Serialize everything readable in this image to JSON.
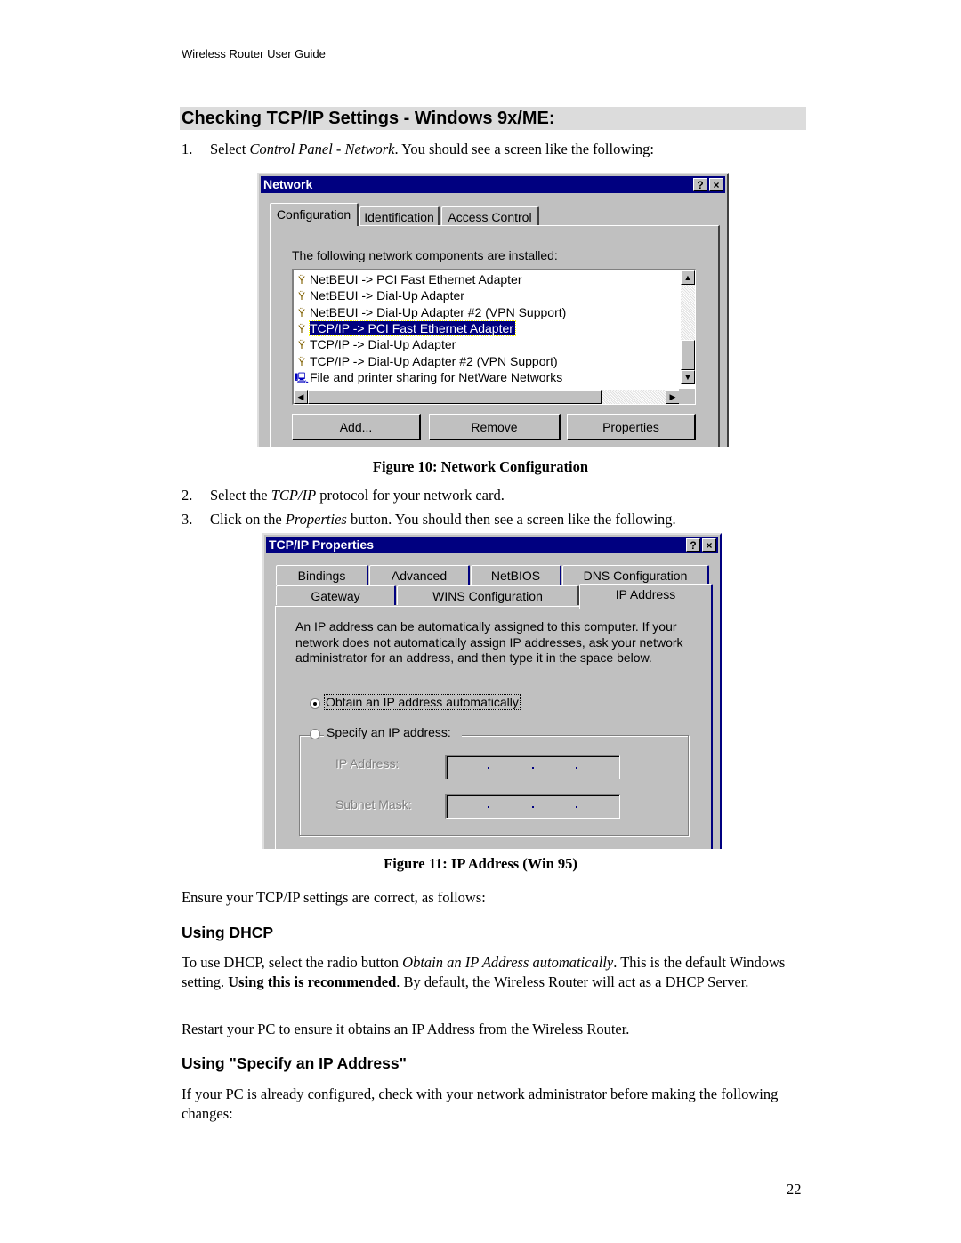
{
  "page": {
    "running_head": "Wireless Router User Guide",
    "section_title": "Checking TCP/IP Settings - Windows 9x/ME:",
    "page_number": "22"
  },
  "steps": [
    {
      "num": "1.",
      "pre": "Select ",
      "em": "Control Panel - Network",
      "post": ". You should see a screen like the following:"
    },
    {
      "num": "2.",
      "pre": "Select the ",
      "em": "TCP/IP",
      "post": " protocol for your network card."
    },
    {
      "num": "3.",
      "pre": "Click on the ",
      "em": "Properties",
      "post": " button. You should then see a screen like the following."
    }
  ],
  "figure10": {
    "caption": "Figure 10: Network Configuration",
    "dialog": {
      "title": "Network",
      "help_button": "?",
      "close_button": "×",
      "tabs": [
        "Configuration",
        "Identification",
        "Access Control"
      ],
      "active_tab": "Configuration",
      "list_label": "The following network components are installed:",
      "list_items": [
        {
          "icon": "network-protocol-icon",
          "label": "NetBEUI -> PCI Fast Ethernet Adapter",
          "selected": false
        },
        {
          "icon": "network-protocol-icon",
          "label": "NetBEUI -> Dial-Up Adapter",
          "selected": false
        },
        {
          "icon": "network-protocol-icon",
          "label": "NetBEUI -> Dial-Up Adapter #2 (VPN Support)",
          "selected": false
        },
        {
          "icon": "network-protocol-icon",
          "label": "TCP/IP -> PCI Fast Ethernet Adapter",
          "selected": true
        },
        {
          "icon": "network-protocol-icon",
          "label": "TCP/IP -> Dial-Up Adapter",
          "selected": false
        },
        {
          "icon": "network-protocol-icon",
          "label": "TCP/IP -> Dial-Up Adapter #2 (VPN Support)",
          "selected": false
        },
        {
          "icon": "computer-sharing-icon",
          "label": "File and printer sharing for NetWare Networks",
          "selected": false
        }
      ],
      "buttons": {
        "add": "Add...",
        "remove": "Remove",
        "properties": "Properties"
      }
    }
  },
  "figure11": {
    "caption": "Figure 11: IP Address (Win 95)",
    "dialog": {
      "title": "TCP/IP Properties",
      "help_button": "?",
      "close_button": "×",
      "tabs_row1": [
        "Bindings",
        "Advanced",
        "NetBIOS",
        "DNS Configuration"
      ],
      "tabs_row2": [
        "Gateway",
        "WINS Configuration",
        "IP Address"
      ],
      "active_tab": "IP Address",
      "description": "An IP address can be automatically assigned to this computer. If your network does not automatically assign IP addresses, ask your network administrator for an address, and then type it in the space below.",
      "radio_auto": {
        "label": "Obtain an IP address automatically",
        "checked": true
      },
      "radio_specify": {
        "label": "Specify an IP address:",
        "checked": false
      },
      "ip_address_label": "IP Address:",
      "ip_address_value": "",
      "subnet_mask_label": "Subnet Mask:",
      "subnet_mask_value": ""
    }
  },
  "body": {
    "ensure_text": "Ensure your TCP/IP settings are correct, as follows:",
    "dhcp_heading": "Using DHCP",
    "dhcp_p1_a": "To use DHCP, select the radio button ",
    "dhcp_p1_em": "Obtain an IP Address automatically",
    "dhcp_p1_b": ". This is the default Windows setting. ",
    "dhcp_p1_strong": "Using this is recommended",
    "dhcp_p1_c": ". By default, the Wireless Router will act as a DHCP Server.",
    "dhcp_p2": "Restart your PC to ensure it obtains an IP Address from the Wireless Router.",
    "specify_heading": "Using \"Specify an IP Address\"",
    "specify_p1": "If your PC is already configured, check with your network administrator before making the following changes:"
  }
}
